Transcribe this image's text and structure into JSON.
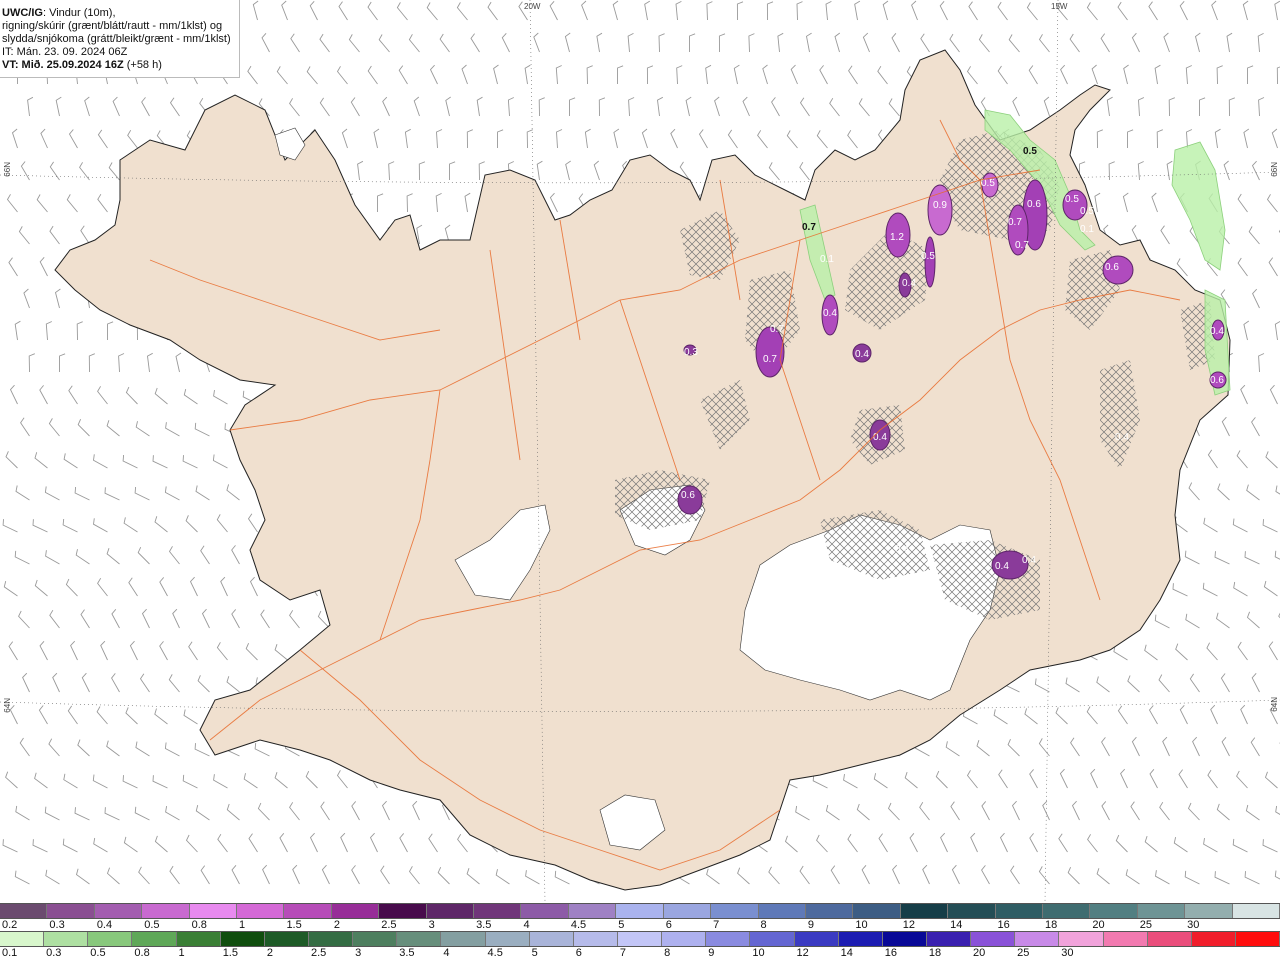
{
  "header": {
    "model": "UWC/IG",
    "line1_rest": ": Vindur (10m),",
    "line2": "rigning/skúrir (grænt/blátt/rautt - mm/1klst) og",
    "line3": "slydda/snjókoma (grátt/bleikt/grænt - mm/1klst)",
    "line4": "IT: Mán. 23. 09. 2024 06Z",
    "line5_bold": "VT: Mið. 25.09.2024 16Z",
    "line5_rest": " (+58 h)"
  },
  "grid_labels": {
    "lon_20w": "20W",
    "lon_15w": "15W",
    "lat_66n_left": "66N",
    "lat_66n_right": "66N",
    "lat_64n_left": "64N",
    "lat_64n_right": "64N"
  },
  "map_values": [
    "0.5",
    "0.7",
    "0.5",
    "0.9",
    "0.5",
    "0.6",
    "0.7",
    "0.7",
    "0.5",
    "0.6",
    "1.2",
    "0.5",
    "0.4",
    "0.1",
    "0.4",
    "0.7",
    "0.7",
    "0.3",
    "0.4",
    "0.4",
    "0.6",
    "0.4",
    "0.4",
    "0.4",
    "0.4",
    "0.6",
    "0.4",
    "0.1"
  ],
  "legend_snow": {
    "colors": [
      "#6b4b6f",
      "#8a4f92",
      "#a35db0",
      "#c86ad0",
      "#e88aef",
      "#d469d6",
      "#b64cb8",
      "#972d98",
      "#480b4c",
      "#5e2768",
      "#70367a",
      "#8d5ba7",
      "#9f81c4",
      "#aab3ee",
      "#9aa6e0",
      "#7a8fd0",
      "#5f79b8",
      "#4e6a9e",
      "#3d5d84",
      "#163e48",
      "#244e56",
      "#2f5d64",
      "#3f6c70",
      "#527f82",
      "#6e9495",
      "#93aeae",
      "#d8e4e4"
    ],
    "labels": [
      "0.2",
      "0.3",
      "0.4",
      "0.5",
      "0.8",
      "1",
      "1.5",
      "2",
      "2.5",
      "3",
      "3.5",
      "4",
      "4.5",
      "5",
      "6",
      "7",
      "8",
      "9",
      "10",
      "12",
      "14",
      "16",
      "18",
      "20",
      "25",
      "30"
    ]
  },
  "legend_rain": {
    "colors": [
      "#d8f7cc",
      "#aee0a2",
      "#88c87c",
      "#5fa858",
      "#3a7f35",
      "#104e0e",
      "#1e5b27",
      "#346c43",
      "#4e7f5f",
      "#678f7c",
      "#849fa1",
      "#9aaec0",
      "#a9b4d9",
      "#b6bbea",
      "#c3c6f7",
      "#aeb1ef",
      "#8a8be0",
      "#6466d2",
      "#3b3bc2",
      "#1c1cb2",
      "#090997",
      "#3a20b0",
      "#8a52d8",
      "#c88ae8",
      "#f1a3db",
      "#f27ab0",
      "#ea4e7c",
      "#f01d2b",
      "#ff0d0d"
    ],
    "labels": [
      "0.1",
      "0.3",
      "0.5",
      "0.8",
      "1",
      "1.5",
      "2",
      "2.5",
      "3",
      "3.5",
      "4",
      "4.5",
      "5",
      "6",
      "7",
      "8",
      "9",
      "10",
      "12",
      "14",
      "16",
      "18",
      "20",
      "25",
      "30"
    ]
  }
}
